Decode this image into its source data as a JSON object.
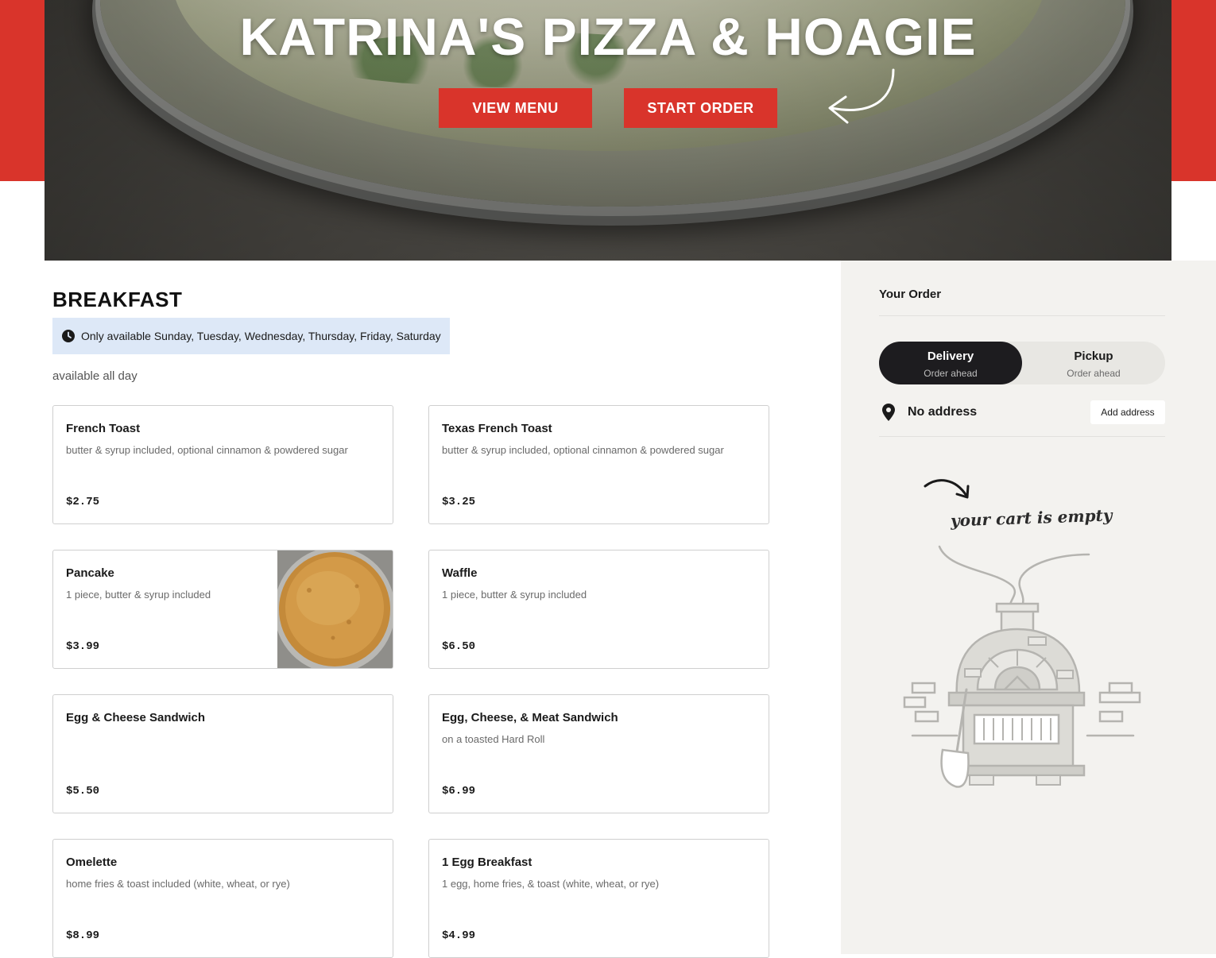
{
  "hero": {
    "title": "KATRINA'S PIZZA & HOAGIE",
    "view_menu_label": "VIEW MENU",
    "start_order_label": "START ORDER"
  },
  "menu": {
    "section_title": "BREAKFAST",
    "availability": "Only available Sunday, Tuesday, Wednesday, Thursday, Friday, Saturday",
    "description": "available all day",
    "items": [
      {
        "name": "French Toast",
        "description": "butter & syrup included, optional cinnamon & powdered sugar",
        "price": "$2.75"
      },
      {
        "name": "Texas French Toast",
        "description": "butter & syrup included, optional cinnamon & powdered sugar",
        "price": "$3.25"
      },
      {
        "name": "Pancake",
        "description": "1 piece, butter & syrup included",
        "price": "$3.99"
      },
      {
        "name": "Waffle",
        "description": "1 piece, butter & syrup included",
        "price": "$6.50"
      },
      {
        "name": "Egg & Cheese Sandwich",
        "description": "",
        "price": "$5.50"
      },
      {
        "name": "Egg, Cheese, & Meat Sandwich",
        "description": "on a toasted Hard Roll",
        "price": "$6.99"
      },
      {
        "name": "Omelette",
        "description": "home fries & toast included (white, wheat, or rye)",
        "price": "$8.99"
      },
      {
        "name": "1 Egg Breakfast",
        "description": "1 egg, home fries, & toast (white, wheat, or rye)",
        "price": "$4.99"
      }
    ]
  },
  "order": {
    "title": "Your Order",
    "delivery_label": "Delivery",
    "delivery_sub": "Order ahead",
    "pickup_label": "Pickup",
    "pickup_sub": "Order ahead",
    "address_text": "No address",
    "add_address_label": "Add address",
    "empty_text": "your cart is empty"
  },
  "colors": {
    "brand_red": "#d9342b",
    "toggle_active": "#1d1c1f",
    "sidebar_bg": "#f3f2ef",
    "notice_bg": "#dde8f7"
  },
  "icons": [
    "clock-icon",
    "location-pin-icon",
    "curved-arrow-icon",
    "pizza-oven-illustration"
  ]
}
